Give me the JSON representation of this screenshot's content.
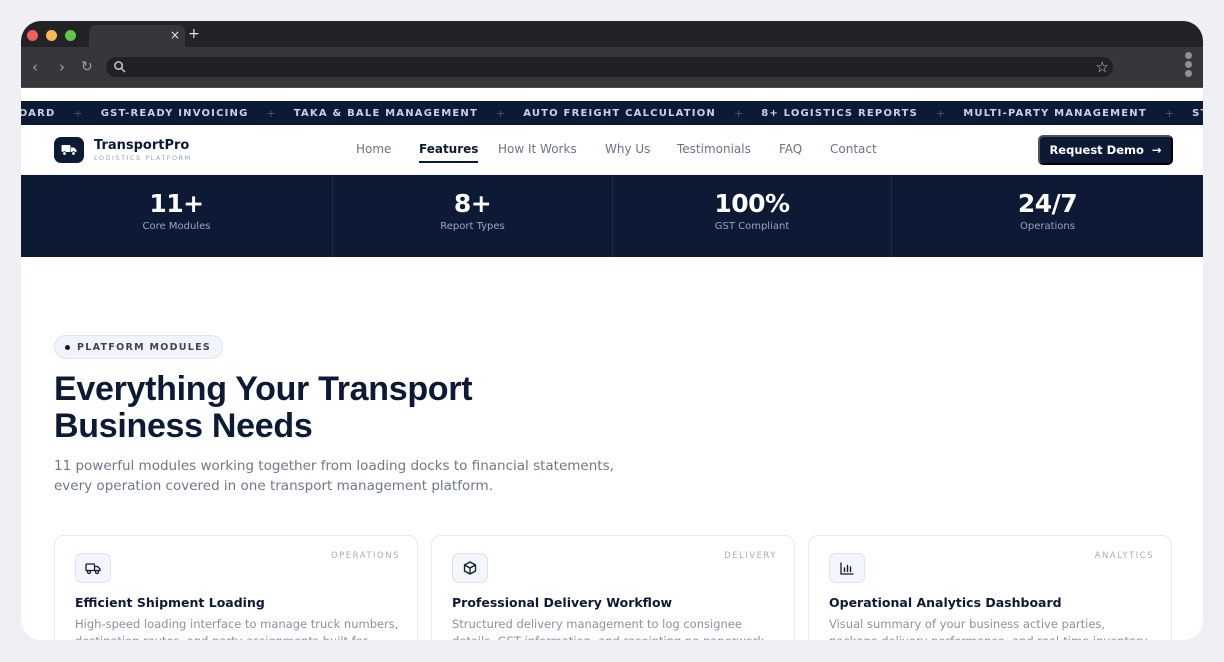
{
  "browser": {
    "tab_close": "×",
    "new_tab": "+",
    "back": "‹",
    "forward": "›",
    "reload": "↻",
    "star": "☆"
  },
  "ticker": {
    "items": [
      "ASHBOARD",
      "GST-READY INVOICING",
      "TAKA & BALE MANAGEMENT",
      "AUTO FREIGHT CALCULATION",
      "8+ LOGISTICS REPORTS",
      "MULTI-PARTY MANAGEMENT",
      "STAND"
    ],
    "separator": "+"
  },
  "header": {
    "logo_name": "TransportPro",
    "logo_tagline": "LOGISTICS PLATFORM",
    "nav": [
      {
        "label": "Home",
        "active": false
      },
      {
        "label": "Features",
        "active": true
      },
      {
        "label": "How It Works",
        "active": false
      },
      {
        "label": "Why Us",
        "active": false
      },
      {
        "label": "Testimonials",
        "active": false
      },
      {
        "label": "FAQ",
        "active": false
      },
      {
        "label": "Contact",
        "active": false
      }
    ],
    "cta_label": "Request Demo",
    "cta_arrow": "→"
  },
  "stats": [
    {
      "value": "11+",
      "label": "Core Modules"
    },
    {
      "value": "8+",
      "label": "Report Types"
    },
    {
      "value": "100%",
      "label": "GST Compliant"
    },
    {
      "value": "24/7",
      "label": "Operations"
    }
  ],
  "features": {
    "badge": "PLATFORM MODULES",
    "headline_line1": "Everything Your Transport",
    "headline_line2": "Business Needs",
    "subhead": "11 powerful modules working together from loading docks to financial statements, every operation covered in one transport management platform.",
    "cards": [
      {
        "icon": "truck-icon",
        "category": "OPERATIONS",
        "title": "Efficient Shipment Loading",
        "description": "High-speed loading interface to manage truck numbers, destination routes, and party assignments built for speed."
      },
      {
        "icon": "package-icon",
        "category": "DELIVERY",
        "title": "Professional Delivery Workflow",
        "description": "Structured delivery management to log consignee details, GST information, and receipting no paperwork missed."
      },
      {
        "icon": "bar-chart-icon",
        "category": "ANALYTICS",
        "title": "Operational Analytics Dashboard",
        "description": "Visual summary of your business active parties, package delivery performance, and real-time inventory status at a glance."
      }
    ]
  },
  "colors": {
    "navy": "#0d1a36",
    "muted_text": "#6f7889"
  }
}
